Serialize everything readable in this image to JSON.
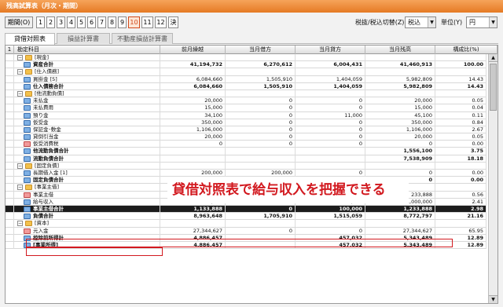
{
  "window": {
    "title": "残高試算表（月次・期間）"
  },
  "toolbar": {
    "period_button": "期間(O)",
    "months": [
      "1",
      "2",
      "3",
      "4",
      "5",
      "6",
      "7",
      "8",
      "9",
      "10",
      "11",
      "12",
      "決"
    ],
    "active_month": "10",
    "tax_label": "税抜/税込切替(Z)",
    "tax_value": "税込",
    "unit_label": "単位(Y)",
    "unit_value": "円"
  },
  "tabs": [
    "貸借対照表",
    "損益計算書",
    "不動産損益計算書"
  ],
  "active_tab": 0,
  "table": {
    "headers": [
      "1",
      "勘定科目",
      "前月繰越",
      "当月借方",
      "当月貸方",
      "当月残高",
      "構成比(%)"
    ],
    "rows": [
      {
        "label": "[現金]",
        "kind": "group",
        "icon": "folder",
        "toggle": "−",
        "level": 0,
        "values": [
          "",
          "",
          "",
          "",
          ""
        ],
        "bold": false
      },
      {
        "label": "資産合計",
        "kind": "total",
        "icon": "acct",
        "level": 1,
        "values": [
          "41,194,732",
          "6,270,612",
          "6,004,431",
          "41,460,913",
          "100.00"
        ],
        "bold": true
      },
      {
        "label": "[仕入債務]",
        "kind": "group",
        "icon": "folder",
        "toggle": "−",
        "level": 0,
        "values": [
          "",
          "",
          "",
          "",
          ""
        ],
        "bold": false
      },
      {
        "label": "買掛金 [5]",
        "kind": "account",
        "icon": "acct",
        "level": 1,
        "values": [
          "6,084,660",
          "1,505,910",
          "1,404,059",
          "5,982,809",
          "14.43"
        ],
        "bold": false
      },
      {
        "label": "仕入債務合計",
        "kind": "total",
        "icon": "acct",
        "level": 1,
        "values": [
          "6,084,660",
          "1,505,910",
          "1,404,059",
          "5,982,809",
          "14.43"
        ],
        "bold": true
      },
      {
        "label": "[他流動負債]",
        "kind": "group",
        "icon": "folder",
        "toggle": "−",
        "level": 0,
        "values": [
          "",
          "",
          "",
          "",
          ""
        ],
        "bold": false
      },
      {
        "label": "未払金",
        "kind": "account",
        "icon": "acct",
        "level": 1,
        "values": [
          "20,000",
          "0",
          "0",
          "20,000",
          "0.05"
        ],
        "bold": false
      },
      {
        "label": "未払費用",
        "kind": "account",
        "icon": "acct",
        "level": 1,
        "values": [
          "15,000",
          "0",
          "0",
          "15,000",
          "0.04"
        ],
        "bold": false
      },
      {
        "label": "預り金",
        "kind": "account",
        "icon": "acct",
        "level": 1,
        "values": [
          "34,100",
          "0",
          "11,000",
          "45,100",
          "0.11"
        ],
        "bold": false
      },
      {
        "label": "仮受金",
        "kind": "account",
        "icon": "acct",
        "level": 1,
        "values": [
          "350,000",
          "0",
          "0",
          "350,000",
          "0.84"
        ],
        "bold": false
      },
      {
        "label": "保証金･敷金",
        "kind": "account",
        "icon": "acct",
        "level": 1,
        "values": [
          "1,106,000",
          "0",
          "0",
          "1,106,000",
          "2.67"
        ],
        "bold": false
      },
      {
        "label": "貸倒引当金",
        "kind": "account",
        "icon": "acct",
        "level": 1,
        "values": [
          "20,000",
          "0",
          "0",
          "20,000",
          "0.05"
        ],
        "bold": false
      },
      {
        "label": "仮受消費税",
        "kind": "account",
        "icon": "acct-red",
        "level": 1,
        "values": [
          "0",
          "0",
          "0",
          "0",
          "0.00"
        ],
        "bold": false
      },
      {
        "label": "他流動負債合計",
        "kind": "total",
        "icon": "acct",
        "level": 1,
        "values": [
          "",
          "",
          "",
          "1,556,100",
          "3.75"
        ],
        "bold": true
      },
      {
        "label": "流動負債合計",
        "kind": "total",
        "icon": "acct",
        "level": 1,
        "values": [
          "",
          "",
          "",
          "7,538,909",
          "18.18"
        ],
        "bold": true
      },
      {
        "label": "[固定負債]",
        "kind": "group",
        "icon": "folder",
        "toggle": "−",
        "level": 0,
        "values": [
          "",
          "",
          "",
          "",
          ""
        ],
        "bold": false
      },
      {
        "label": "長期借入金 [1]",
        "kind": "account",
        "icon": "acct",
        "level": 1,
        "values": [
          "200,000",
          "200,000",
          "0",
          "0",
          "0.00"
        ],
        "bold": false
      },
      {
        "label": "固定負債合計",
        "kind": "total",
        "icon": "acct",
        "level": 1,
        "values": [
          "200,000",
          "200,000",
          "0",
          "0",
          "0.00"
        ],
        "bold": true
      },
      {
        "label": "[事業主借]",
        "kind": "group",
        "icon": "folder",
        "toggle": "−",
        "level": 0,
        "values": [
          "",
          "",
          "",
          "",
          ""
        ],
        "bold": false
      },
      {
        "label": "事業主借",
        "kind": "account",
        "icon": "acct-red",
        "level": 1,
        "values": [
          "233,888",
          "0",
          "0",
          "233,888",
          "0.56"
        ],
        "bold": false
      },
      {
        "label": "給与収入",
        "kind": "account",
        "icon": "acct",
        "level": 1,
        "values": [
          "900,000",
          "0",
          "100,000",
          "1,000,000",
          "2.41"
        ],
        "bold": false
      },
      {
        "label": "事業主借合計",
        "kind": "total",
        "icon": "acct",
        "level": 1,
        "values": [
          "1,133,888",
          "0",
          "100,000",
          "1,233,888",
          "2.98"
        ],
        "bold": true,
        "highlight": true
      },
      {
        "label": "負債合計",
        "kind": "total",
        "icon": "acct",
        "level": 1,
        "values": [
          "8,963,648",
          "1,705,910",
          "1,515,059",
          "8,772,797",
          "21.16"
        ],
        "bold": true
      },
      {
        "label": "[資本]",
        "kind": "group",
        "icon": "folder",
        "toggle": "−",
        "level": 0,
        "values": [
          "",
          "",
          "",
          "",
          ""
        ],
        "bold": false
      },
      {
        "label": "元入金",
        "kind": "account",
        "icon": "acct-red",
        "level": 1,
        "values": [
          "27,344,627",
          "0",
          "0",
          "27,344,627",
          "65.95"
        ],
        "bold": false
      },
      {
        "label": "控除前所得計",
        "kind": "total",
        "icon": "acct",
        "level": 1,
        "values": [
          "4,886,457",
          "",
          "457,032",
          "5,343,489",
          "12.89"
        ],
        "bold": true
      },
      {
        "label": "[事業所得]",
        "kind": "total",
        "icon": "acct",
        "level": 1,
        "values": [
          "4,886,457",
          "",
          "457,032",
          "5,343,489",
          "12.89"
        ],
        "bold": true
      }
    ]
  },
  "annotation": {
    "text": "貸借対照表で給与収入を把握できる"
  },
  "scrollbar": {
    "up": "▲",
    "down": "▼"
  }
}
